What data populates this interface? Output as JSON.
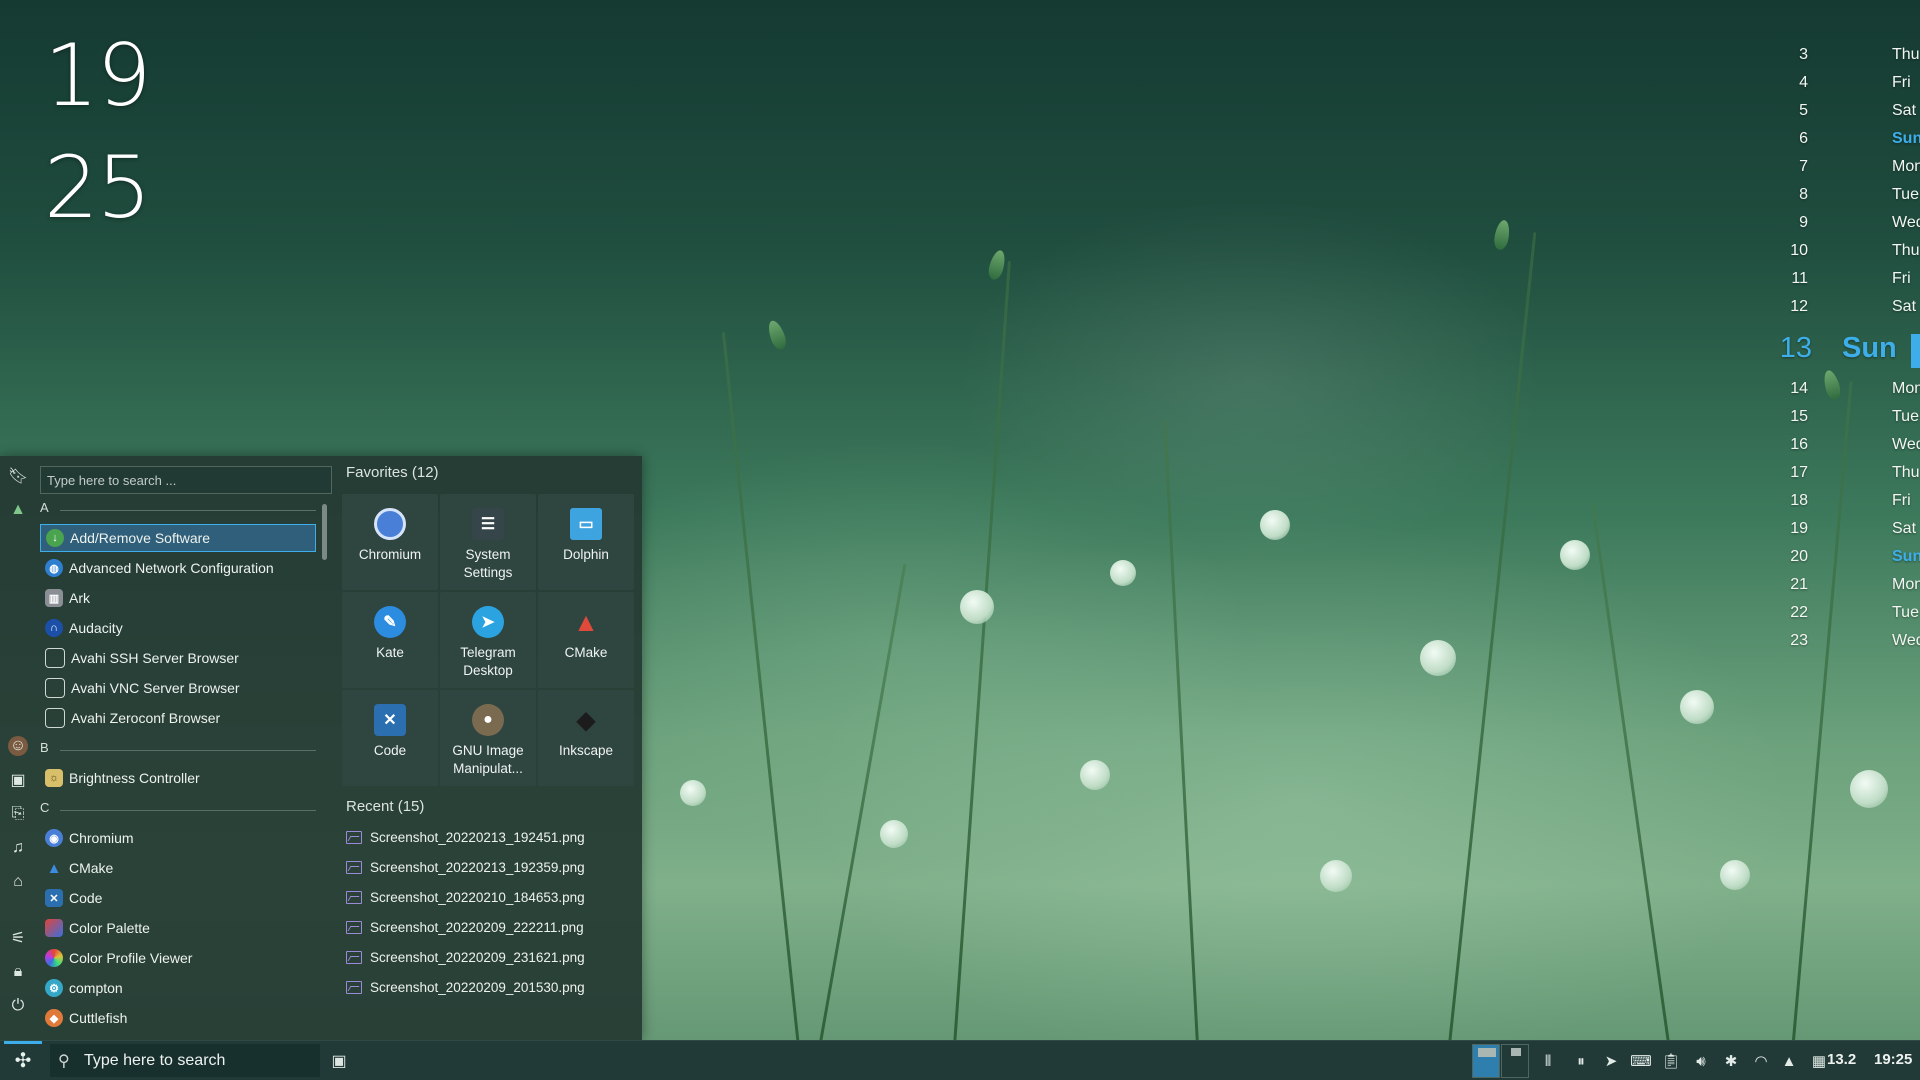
{
  "clock": {
    "hours": "19",
    "minutes": "25"
  },
  "calendar": [
    {
      "num": "3",
      "day": "Thu"
    },
    {
      "num": "4",
      "day": "Fri"
    },
    {
      "num": "5",
      "day": "Sat"
    },
    {
      "num": "6",
      "day": "Sun"
    },
    {
      "num": "7",
      "day": "Mon"
    },
    {
      "num": "8",
      "day": "Tue"
    },
    {
      "num": "9",
      "day": "Wed"
    },
    {
      "num": "10",
      "day": "Thu"
    },
    {
      "num": "11",
      "day": "Fri"
    },
    {
      "num": "12",
      "day": "Sat"
    },
    {
      "num": "13",
      "day": "Sun"
    },
    {
      "num": "14",
      "day": "Mon"
    },
    {
      "num": "15",
      "day": "Tue"
    },
    {
      "num": "16",
      "day": "Wed"
    },
    {
      "num": "17",
      "day": "Thu"
    },
    {
      "num": "18",
      "day": "Fri"
    },
    {
      "num": "19",
      "day": "Sat"
    },
    {
      "num": "20",
      "day": "Sun"
    },
    {
      "num": "21",
      "day": "Mon"
    },
    {
      "num": "22",
      "day": "Tue"
    },
    {
      "num": "23",
      "day": "Wed"
    }
  ],
  "launcher": {
    "search_placeholder": "Type here to search ...",
    "sidebar_icons": [
      "bookmark-icon",
      "grass-icon",
      "user-avatar-icon",
      "image-icon",
      "document-icon",
      "music-icon",
      "home-icon",
      "settings-sliders-icon",
      "lock-icon",
      "power-icon"
    ],
    "sections": [
      "A",
      "B",
      "C"
    ],
    "apps_a": [
      "Add/Remove Software",
      "Advanced Network Configuration",
      "Ark",
      "Audacity",
      "Avahi SSH Server Browser",
      "Avahi VNC Server Browser",
      "Avahi Zeroconf Browser"
    ],
    "apps_b": [
      "Brightness Controller"
    ],
    "apps_c": [
      "Chromium",
      "CMake",
      "Code",
      "Color Palette",
      "Color Profile Viewer",
      "compton",
      "Cuttlefish"
    ],
    "favorites_title": "Favorites (12)",
    "favorites": [
      "Chromium",
      "System Settings",
      "Dolphin",
      "Kate",
      "Telegram Desktop",
      "CMake",
      "Code",
      "GNU Image Manipulat...",
      "Inkscape"
    ],
    "recent_title": "Recent (15)",
    "recent": [
      "Screenshot_20220213_192451.png",
      "Screenshot_20220213_192359.png",
      "Screenshot_20220210_184653.png",
      "Screenshot_20220209_222211.png",
      "Screenshot_20220209_231621.png",
      "Screenshot_20220209_201530.png"
    ]
  },
  "taskbar": {
    "search_label": "Type here to search",
    "tray_icons": [
      "column-bars-icon",
      "pause-circle-icon",
      "telegram-icon",
      "terminal-icon",
      "clipboard-icon",
      "volume-icon",
      "bluetooth-icon",
      "wifi-icon",
      "arrow-up-icon",
      "calendar-icon"
    ],
    "temperature": "13.2",
    "time": "19:25"
  },
  "colors": {
    "accent": "#3daee9",
    "panel": "#243832",
    "selected": "#2f5f7a"
  }
}
